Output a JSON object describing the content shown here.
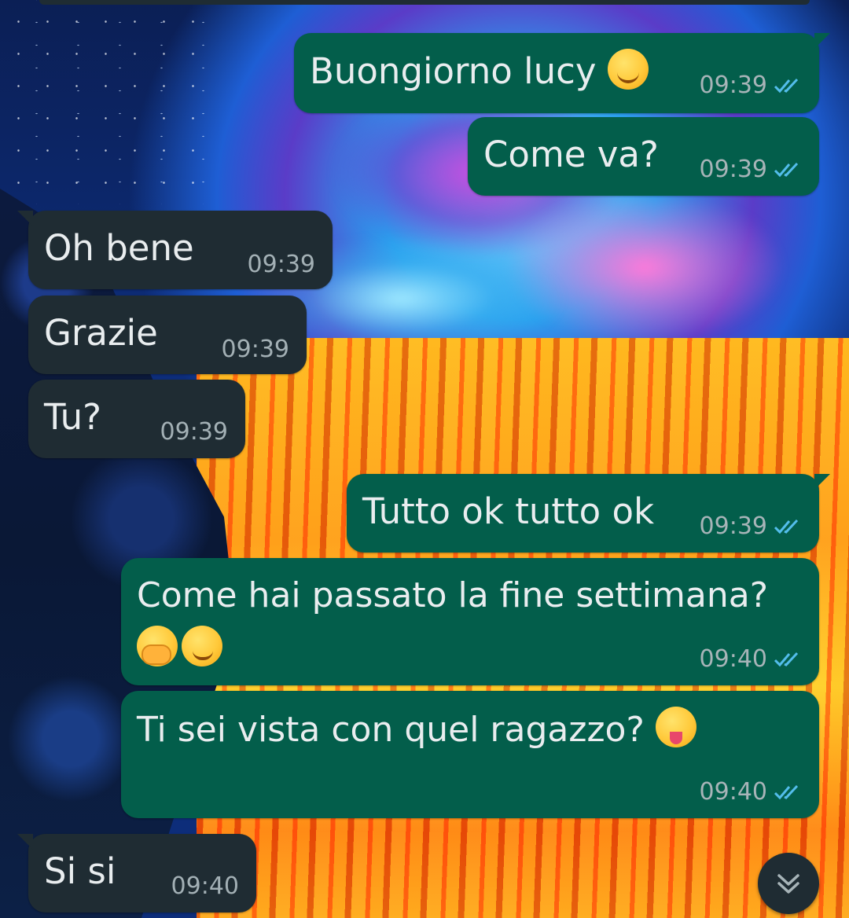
{
  "theme": {
    "outgoing_bubble": "#035e4b",
    "incoming_bubble": "#1f2c33",
    "text": "#e9edef",
    "read_ticks": "#53bdeb"
  },
  "messages": [
    {
      "direction": "out",
      "text": "Buongiorno lucy",
      "emoji": "smiling-face",
      "time": "09:39",
      "status": "read"
    },
    {
      "direction": "out",
      "text": "Come va?",
      "time": "09:39",
      "status": "read"
    },
    {
      "direction": "in",
      "text": "Oh bene",
      "time": "09:39"
    },
    {
      "direction": "in",
      "text": "Grazie",
      "time": "09:39"
    },
    {
      "direction": "in",
      "text": "Tu?",
      "time": "09:39"
    },
    {
      "direction": "out",
      "text": "Tutto ok tutto ok",
      "time": "09:39",
      "status": "read"
    },
    {
      "direction": "out",
      "text": "Come hai passato la fine settimana?",
      "emoji": [
        "hand-over-mouth",
        "winking-face"
      ],
      "time": "09:40",
      "status": "read"
    },
    {
      "direction": "out",
      "text": "Ti sei vista con quel ragazzo?",
      "emoji": "winking-face-with-tongue",
      "time": "09:40",
      "status": "read"
    },
    {
      "direction": "in",
      "text": "Si si",
      "time": "09:40"
    }
  ],
  "scroll_down_button": {
    "icon": "double-chevron-down-icon"
  }
}
